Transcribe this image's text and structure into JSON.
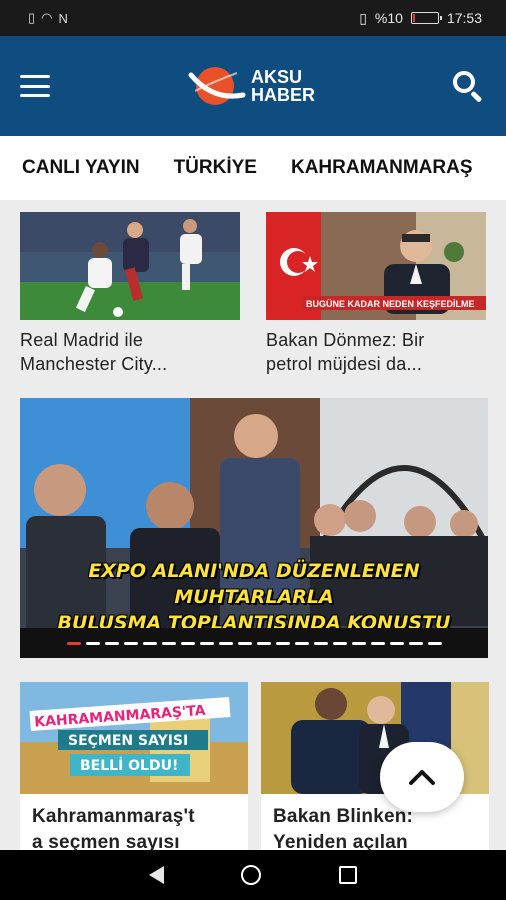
{
  "status_bar": {
    "left_icons": [
      "sim-icon",
      "wifi-icon",
      "nfc-icon"
    ],
    "battery_text": "%10",
    "battery_level": 0.1,
    "time": "17:53"
  },
  "app_bar": {
    "logo_line1": "AKSU",
    "logo_line2": "HABER",
    "brand_color": "#0f4d80",
    "logo_accent": "#e8512a"
  },
  "tabs": [
    "CANLI YAYIN",
    "TÜRKİYE",
    "KAHRAMANMARAŞ"
  ],
  "top_cards": [
    {
      "title_line1": "Real Madrid ile",
      "title_line2": "Manchester City..."
    },
    {
      "title_line1": "Bakan Dönmez: Bir",
      "title_line2": "petrol müjdesi da...",
      "image_caption": "BUGÜNE KADAR NEDEN KEŞFEDİLME"
    }
  ],
  "slider": {
    "caption_line1": "EXPO ALANI'NDA DÜZENLENEN MUHTARLARLA",
    "caption_line2": "BULUŞMA TOPLANTISINDA KONUŞTU",
    "dot_count": 20,
    "active_dot": 0
  },
  "bottom_cards": [
    {
      "title_line1": "Kahramanmaraş't",
      "title_line2": "a seçmen sayısı",
      "image_text1": "KAHRAMANMARAŞ'TA",
      "image_text2": "SEÇMEN SAYISI",
      "image_text3": "BELLİ OLDU!"
    },
    {
      "title_line1": "Bakan Blinken:",
      "title_line2": "Yeniden açılan"
    }
  ],
  "fab": {
    "icon": "chevron-up-icon"
  },
  "nav_bar": {
    "icons": [
      "back-icon",
      "home-icon",
      "recent-apps-icon"
    ]
  }
}
